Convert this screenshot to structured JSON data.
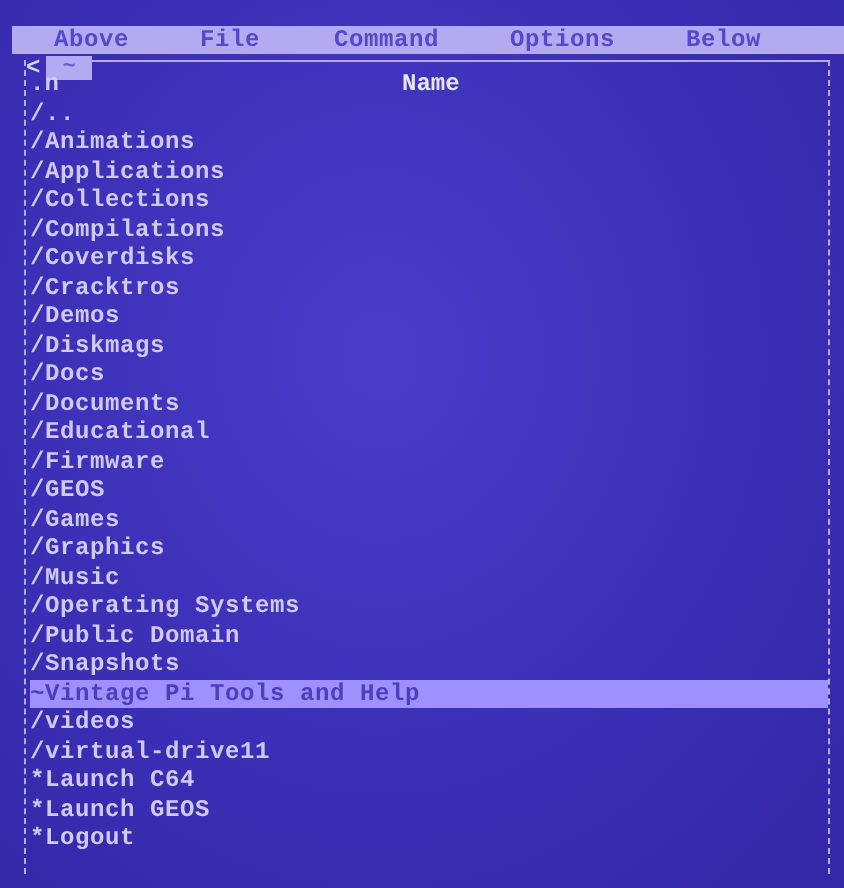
{
  "menu": [
    {
      "label": "Above"
    },
    {
      "label": "File"
    },
    {
      "label": "Command"
    },
    {
      "label": "Options"
    },
    {
      "label": "Below"
    }
  ],
  "panel": {
    "back": "<",
    "path": "~",
    "sort_indicator": ".n",
    "column_header": "Name"
  },
  "entries": [
    {
      "name": "/..",
      "selected": false
    },
    {
      "name": "/Animations",
      "selected": false
    },
    {
      "name": "/Applications",
      "selected": false
    },
    {
      "name": "/Collections",
      "selected": false
    },
    {
      "name": "/Compilations",
      "selected": false
    },
    {
      "name": "/Coverdisks",
      "selected": false
    },
    {
      "name": "/Cracktros",
      "selected": false
    },
    {
      "name": "/Demos",
      "selected": false
    },
    {
      "name": "/Diskmags",
      "selected": false
    },
    {
      "name": "/Docs",
      "selected": false
    },
    {
      "name": "/Documents",
      "selected": false
    },
    {
      "name": "/Educational",
      "selected": false
    },
    {
      "name": "/Firmware",
      "selected": false
    },
    {
      "name": "/GEOS",
      "selected": false
    },
    {
      "name": "/Games",
      "selected": false
    },
    {
      "name": "/Graphics",
      "selected": false
    },
    {
      "name": "/Music",
      "selected": false
    },
    {
      "name": "/Operating Systems",
      "selected": false
    },
    {
      "name": "/Public Domain",
      "selected": false
    },
    {
      "name": "/Snapshots",
      "selected": false
    },
    {
      "name": "~Vintage Pi Tools and Help",
      "selected": true
    },
    {
      "name": "/videos",
      "selected": false
    },
    {
      "name": "/virtual-drive11",
      "selected": false
    },
    {
      "name": "*Launch C64",
      "selected": false
    },
    {
      "name": "*Launch GEOS",
      "selected": false
    },
    {
      "name": "*Logout",
      "selected": false
    }
  ]
}
